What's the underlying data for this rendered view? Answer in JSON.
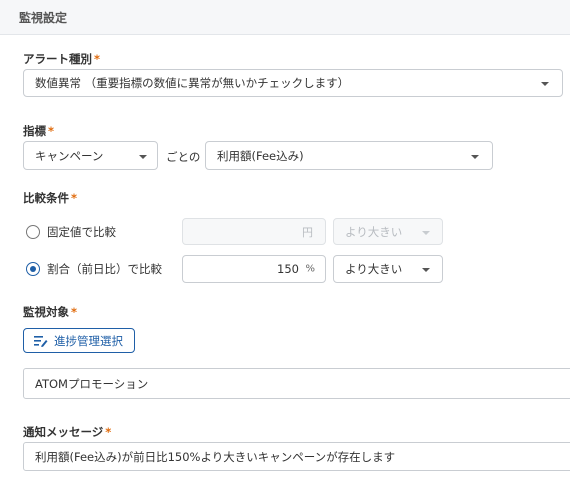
{
  "header": {
    "title": "監視設定"
  },
  "alert_type": {
    "label": "アラート種別",
    "required_mark": "*",
    "value": "数値異常 （重要指標の数値に異常が無いかチェックします）"
  },
  "metric": {
    "label": "指標",
    "required_mark": "*",
    "group_value": "キャンペーン",
    "per_text": "ごとの",
    "metric_value": "利用額(Fee込み)"
  },
  "comparison": {
    "label": "比較条件",
    "required_mark": "*",
    "fixed": {
      "label": "固定値で比較",
      "selected": false,
      "unit": "円",
      "operator": "より大きい"
    },
    "ratio": {
      "label": "割合（前日比）で比較",
      "selected": true,
      "value": "150",
      "unit": "%",
      "operator": "より大きい"
    }
  },
  "target": {
    "label": "監視対象",
    "required_mark": "*",
    "button_label": "進捗管理選択",
    "button_icon": "edit-list-icon",
    "selected_value": "ATOMプロモーション"
  },
  "notification": {
    "label": "通知メッセージ",
    "required_mark": "*",
    "value": "利用額(Fee込み)が前日比150%より大きいキャンペーンが存在します"
  },
  "colors": {
    "accent": "#1f5fa7",
    "required": "#e06b0d",
    "border": "#c9cdd2"
  }
}
